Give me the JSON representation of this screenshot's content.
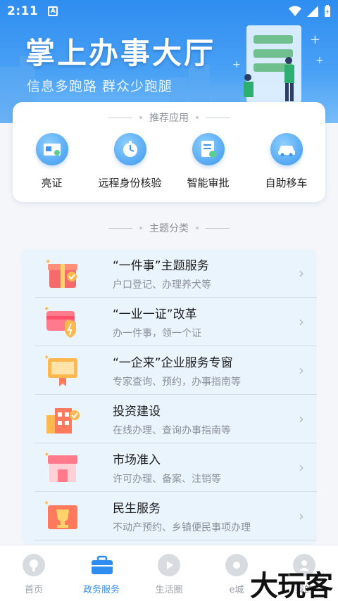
{
  "status": {
    "time": "2:11",
    "a_label": "A"
  },
  "banner": {
    "title": "掌上办事大厅",
    "slogan": "信息多跑路  群众少跑腿"
  },
  "recommended": {
    "title": "推荐应用",
    "apps": [
      {
        "label": "亮证",
        "icon": "id-card-icon"
      },
      {
        "label": "远程身份核验",
        "icon": "stopwatch-icon"
      },
      {
        "label": "智能审批",
        "icon": "document-icon"
      },
      {
        "label": "自助移车",
        "icon": "car-icon"
      }
    ]
  },
  "themes": {
    "title": "主题分类",
    "items": [
      {
        "name": "“一件事”主题服务",
        "desc": "户口登记、办理养犬等",
        "icon": "gift-box-icon"
      },
      {
        "name": "“一业一证”改革",
        "desc": "办一件事，领一个证",
        "icon": "card-shield-icon"
      },
      {
        "name": "“一企来”企业服务专窗",
        "desc": "专家查询、预约，办事指南等",
        "icon": "certificate-icon"
      },
      {
        "name": "投资建设",
        "desc": "在线办理、查询办事指南等",
        "icon": "building-icon"
      },
      {
        "name": "市场准入",
        "desc": "许可办理、备案、注销等",
        "icon": "storefront-icon"
      },
      {
        "name": "民生服务",
        "desc": "不动产预约、乡镇便民事项办理",
        "icon": "trophy-icon"
      }
    ]
  },
  "nav": [
    {
      "label": "首页",
      "active": false
    },
    {
      "label": "政务服务",
      "active": true
    },
    {
      "label": "生活圈",
      "active": false
    },
    {
      "label": "e城",
      "active": false
    },
    {
      "label": "我的",
      "active": false
    }
  ],
  "watermark": "大玩客"
}
